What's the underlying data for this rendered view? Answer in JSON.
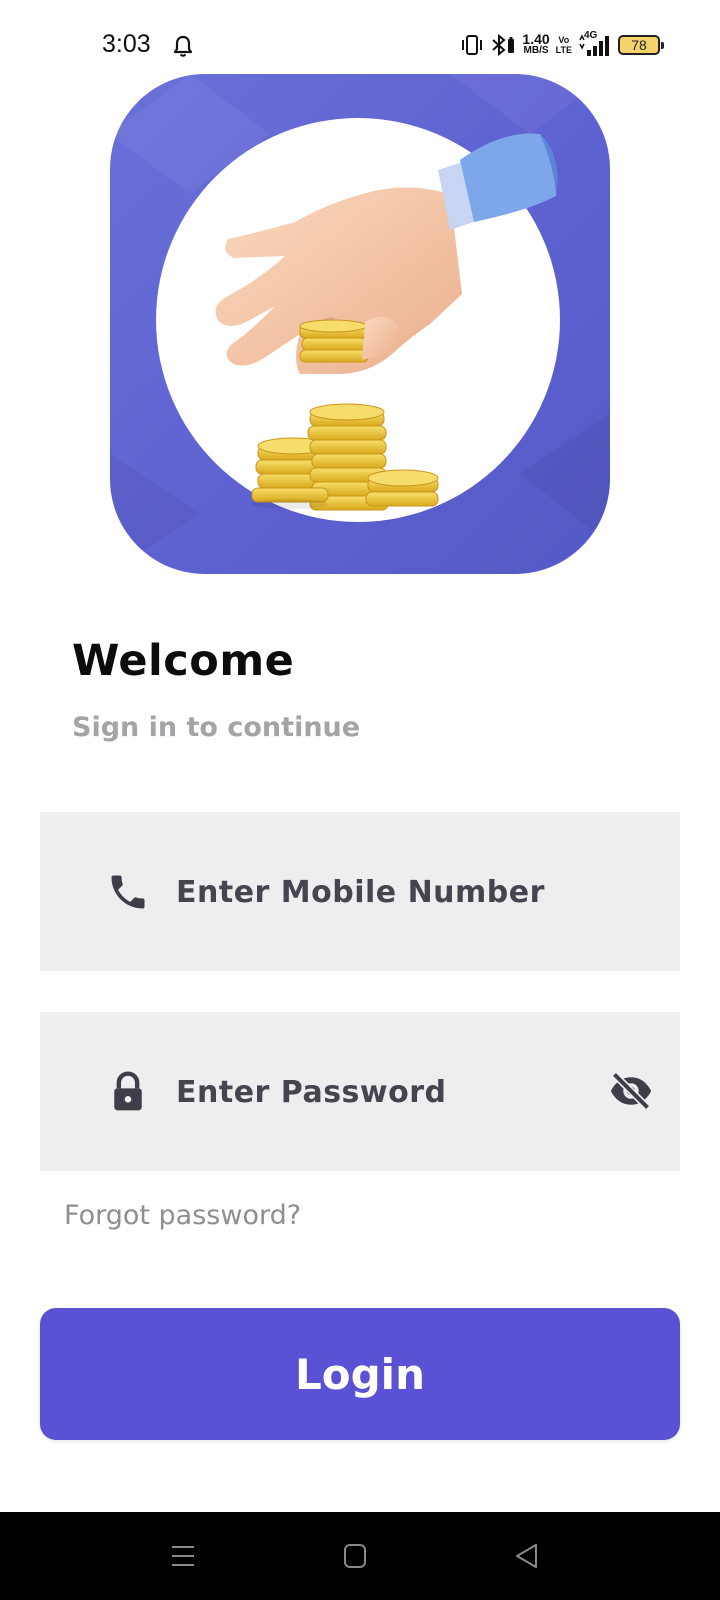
{
  "status_bar": {
    "time": "3:03",
    "speed_value": "1.40",
    "speed_unit": "MB/S",
    "volte_top": "Vo",
    "volte_bottom": "LTE",
    "network_label": "4G",
    "battery_level": "78",
    "icons": [
      "bell-icon",
      "vibrate-icon",
      "bluetooth-icon",
      "signal-icon",
      "battery-icon"
    ]
  },
  "hero": {
    "icon": "hand-with-coins-illustration",
    "bg_color": "#5f63d2"
  },
  "welcome": {
    "title": "Welcome",
    "subtitle": "Sign in to continue"
  },
  "mobile_field": {
    "placeholder": "Enter Mobile Number",
    "icon": "phone-icon"
  },
  "password_field": {
    "placeholder": "Enter Password",
    "icon": "lock-icon",
    "toggle_icon": "eye-off-icon"
  },
  "forgot_label": "Forgot password?",
  "login_label": "Login",
  "colors": {
    "accent": "#5952d4",
    "field_bg": "#eeeeee",
    "subtitle_text": "#a3a3a8"
  },
  "nav_bar": {
    "items": [
      "menu-icon",
      "home-icon",
      "back-icon"
    ]
  }
}
